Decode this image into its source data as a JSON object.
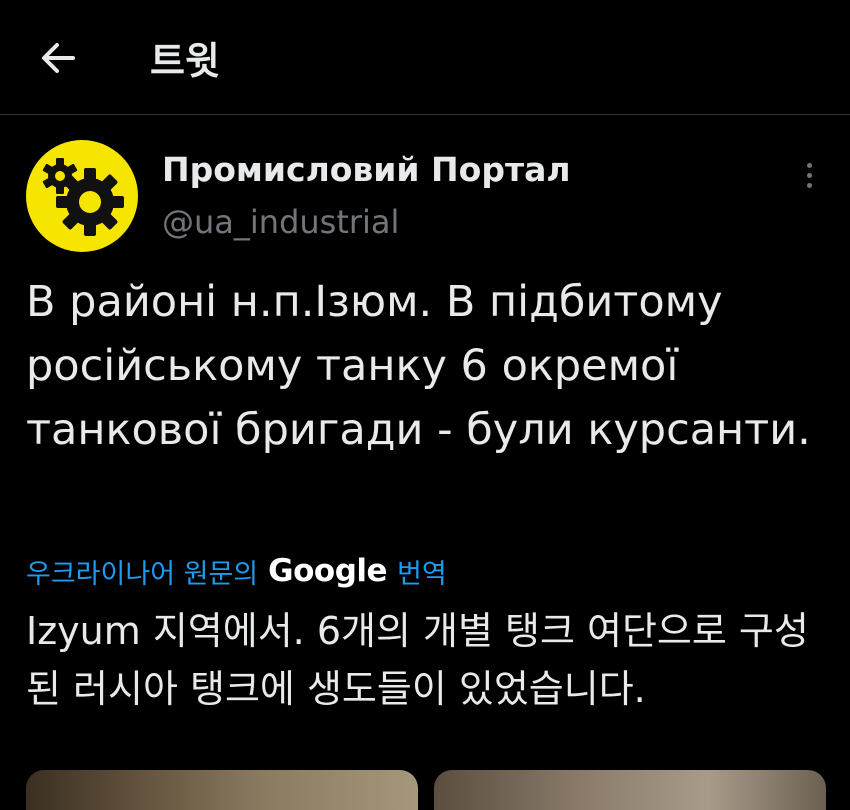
{
  "header": {
    "title": "트윗"
  },
  "tweet": {
    "author_name": "Промисловий Портал",
    "author_handle": "@ua_industrial",
    "text": "В районі н.п.Ізюм. В підбитому російському танку 6 окремої танкової бригади - були курсанти.",
    "translate": {
      "prefix": "우크라이나어 원문의",
      "provider": "Google",
      "suffix": "번역"
    },
    "translated_text": "Izyum 지역에서. 6개의 개별 탱크 여단으로 구성된 러시아 탱크에 생도들이 있었습니다."
  },
  "colors": {
    "background": "#000000",
    "text_primary": "#e7e9ea",
    "text_secondary": "#71767b",
    "link": "#1d9bf0",
    "avatar_bg": "#f6e500",
    "divider": "#2f3336"
  },
  "icons": {
    "back": "arrow-left-icon",
    "more": "more-vertical-icon",
    "avatar": "gear-logo-icon"
  }
}
